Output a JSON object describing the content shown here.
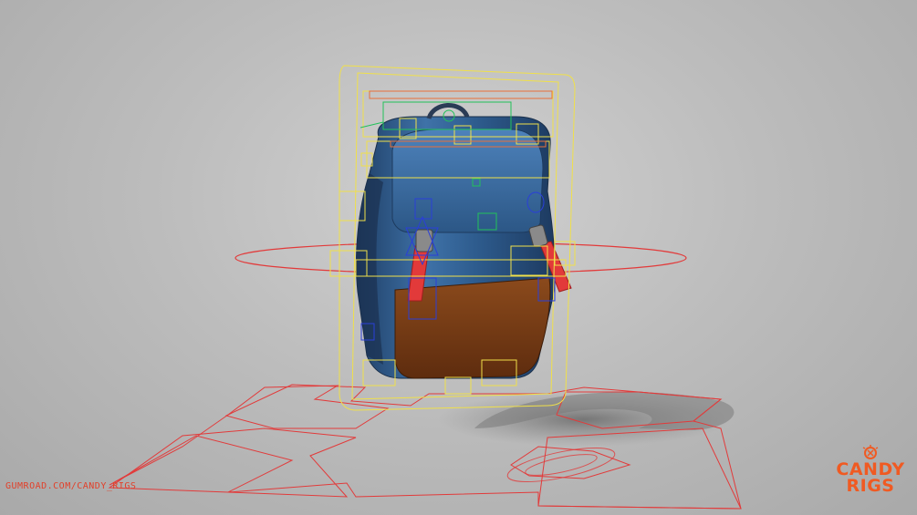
{
  "scene": {
    "subject": "backpack-rig",
    "colors": {
      "background": "#bdbdbd",
      "backpack_blue": "#2f5f8f",
      "backpack_brown": "#7a3a14",
      "strap_red": "#e23a3a",
      "rig_yellow": "#f0e04a",
      "rig_red": "#e23a3a",
      "rig_blue": "#2a3fd8",
      "rig_green": "#22c25a",
      "brand_orange": "#f05a22"
    }
  },
  "watermark": {
    "url": "GUMROAD.COM/CANDY_RIGS"
  },
  "brand": {
    "line1": "CANDY",
    "line2": "RIGS"
  }
}
